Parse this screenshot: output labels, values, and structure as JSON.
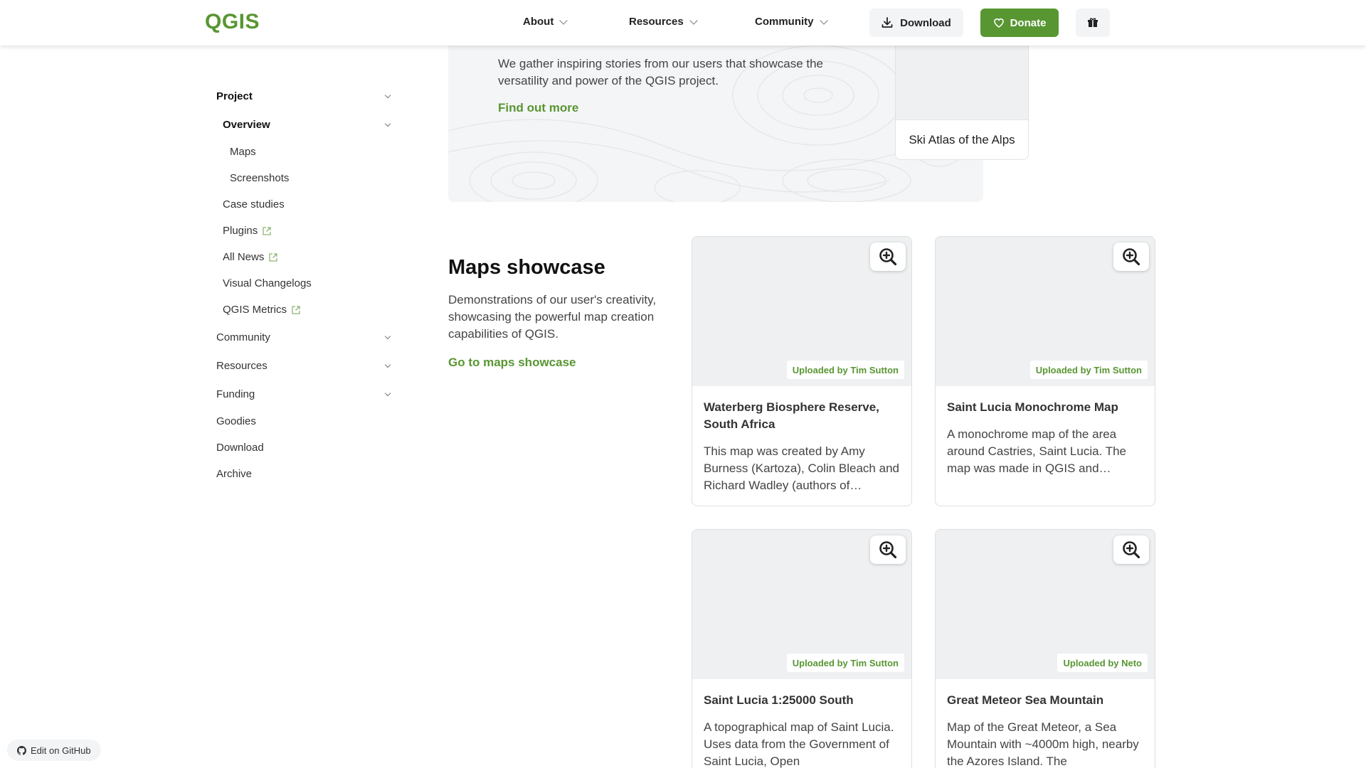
{
  "header": {
    "logo": "QGIS",
    "nav": [
      {
        "label": "About"
      },
      {
        "label": "Resources"
      },
      {
        "label": "Community"
      }
    ],
    "download_label": "Download",
    "donate_label": "Donate"
  },
  "sidebar": {
    "project": "Project",
    "overview": "Overview",
    "maps": "Maps",
    "screenshots": "Screenshots",
    "case_studies": "Case studies",
    "plugins": "Plugins",
    "all_news": "All News",
    "visual_changelogs": "Visual Changelogs",
    "qgis_metrics": "QGIS Metrics",
    "community": "Community",
    "resources": "Resources",
    "funding": "Funding",
    "goodies": "Goodies",
    "download": "Download",
    "archive": "Archive"
  },
  "stories": {
    "text": "We gather inspiring stories from our users that showcase the versatility and power of the QGIS project.",
    "link": "Find out more",
    "card_caption": "Ski Atlas of the Alps"
  },
  "showcase": {
    "title": "Maps showcase",
    "description": "Demonstrations of our user's creativity, showcasing the powerful map creation capabilities of QGIS.",
    "link": "Go to maps showcase",
    "cards": [
      {
        "uploader": "Uploaded by Tim Sutton",
        "title": "Waterberg Biosphere Reserve, South Africa",
        "description": "This map was created by Amy Burness (Kartoza), Colin Bleach and Richard Wadley (authors of…"
      },
      {
        "uploader": "Uploaded by Tim Sutton",
        "title": "Saint Lucia Monochrome Map",
        "description": "A monochrome map of the area around Castries, Saint Lucia. The map was made in QGIS and includes data from diverse source…"
      },
      {
        "uploader": "Uploaded by Tim Sutton",
        "title": "Saint Lucia 1:25000 South",
        "description": "A topographical map of Saint Lucia. Uses data from the Government of Saint Lucia, Open"
      },
      {
        "uploader": "Uploaded by Neto",
        "title": "Great Meteor Sea Mountain",
        "description": "Map of the Great Meteor, a Sea Mountain with ~4000m high, nearby the Azores Island. The"
      }
    ]
  },
  "footer": {
    "edit_github": "Edit on GitHub"
  },
  "colors": {
    "brand_green": "#589632",
    "placeholder_gray": "#eef0f1"
  }
}
